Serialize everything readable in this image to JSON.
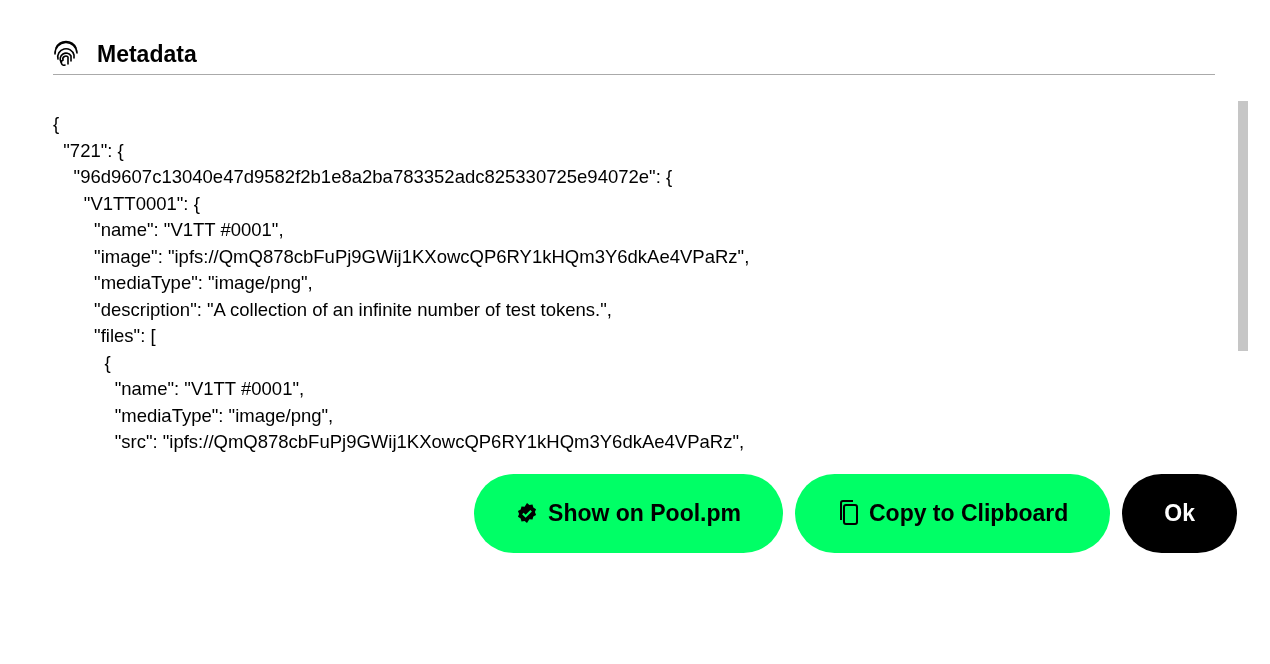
{
  "header": {
    "title": "Metadata"
  },
  "metadata_lines": [
    "{",
    "  \"721\": {",
    "    \"96d9607c13040e47d9582f2b1e8a2ba783352adc825330725e94072e\": {",
    "      \"V1TT0001\": {",
    "        \"name\": \"V1TT #0001\",",
    "        \"image\": \"ipfs://QmQ878cbFuPj9GWij1KXowcQP6RY1kHQm3Y6dkAe4VPaRz\",",
    "        \"mediaType\": \"image/png\",",
    "        \"description\": \"A collection of an infinite number of test tokens.\",",
    "        \"files\": [",
    "          {",
    "            \"name\": \"V1TT #0001\",",
    "            \"mediaType\": \"image/png\",",
    "            \"src\": \"ipfs://QmQ878cbFuPj9GWij1KXowcQP6RY1kHQm3Y6dkAe4VPaRz\","
  ],
  "buttons": [
    {
      "kind": "verified",
      "label": "Show on Pool.pm"
    },
    {
      "kind": "copy",
      "label": "Copy to Clipboard"
    },
    {
      "kind": "primary",
      "label": "Ok"
    }
  ]
}
